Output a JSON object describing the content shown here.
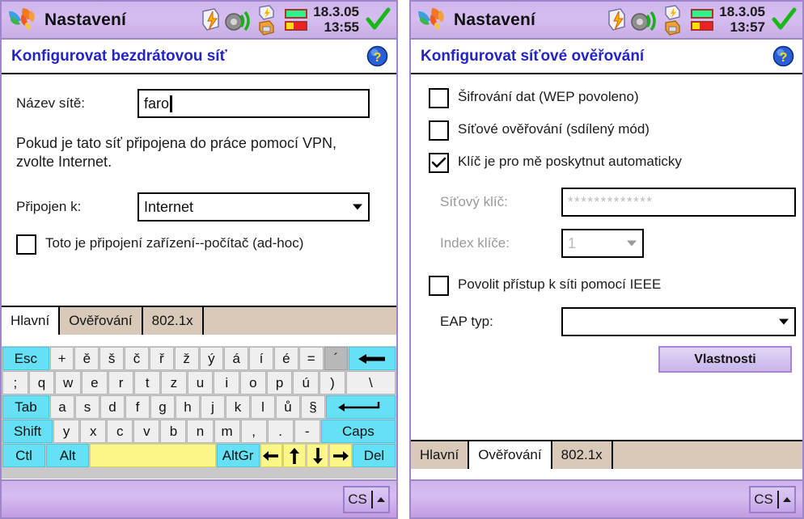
{
  "windows": [
    {
      "id": "wireless",
      "titlebar": {
        "app_title": "Nastavení",
        "date": "18.3.05",
        "time": "13:55",
        "icons": [
          "msn-butterfly-logo",
          "power-icon",
          "speaker-icon",
          "network-icon",
          "battery-green",
          "battery-red",
          "ok-check-icon"
        ]
      },
      "header": {
        "title": "Konfigurovat bezdrátovou síť",
        "help_icon": "help-question-icon"
      },
      "form": {
        "network_name_label": "Název sítě:",
        "network_name_value": "faro",
        "help_text": "Pokud je tato síť připojena do práce pomocí VPN, zvolte  Internet.",
        "connects_to_label": "Připojen k:",
        "connects_to_value": "Internet",
        "adhoc_label": "Toto je připojení  zařízení--počítač (ad-hoc)",
        "adhoc_checked": false
      },
      "tabs": [
        {
          "label": "Hlavní",
          "active": true
        },
        {
          "label": "Ověřování",
          "active": false
        },
        {
          "label": "802.1x",
          "active": false
        }
      ],
      "keyboard": {
        "rows": [
          [
            {
              "label": "Esc",
              "style": "cy",
              "width": "w2"
            },
            {
              "label": "+",
              "style": "",
              "width": ""
            },
            {
              "label": "ě",
              "style": "",
              "width": ""
            },
            {
              "label": "š",
              "style": "",
              "width": ""
            },
            {
              "label": "č",
              "style": "",
              "width": ""
            },
            {
              "label": "ř",
              "style": "",
              "width": ""
            },
            {
              "label": "ž",
              "style": "",
              "width": ""
            },
            {
              "label": "ý",
              "style": "",
              "width": ""
            },
            {
              "label": "á",
              "style": "",
              "width": ""
            },
            {
              "label": "í",
              "style": "",
              "width": ""
            },
            {
              "label": "é",
              "style": "",
              "width": ""
            },
            {
              "label": "=",
              "style": "",
              "width": ""
            },
            {
              "label": "´",
              "style": "gr",
              "width": ""
            },
            {
              "label": "backspace-arrow-icon",
              "style": "cy",
              "width": "w2",
              "icon": "backspace"
            }
          ],
          [
            {
              "label": ";",
              "style": "",
              "width": ""
            },
            {
              "label": "q",
              "style": "",
              "width": ""
            },
            {
              "label": "w",
              "style": "",
              "width": ""
            },
            {
              "label": "e",
              "style": "",
              "width": ""
            },
            {
              "label": "r",
              "style": "",
              "width": ""
            },
            {
              "label": "t",
              "style": "",
              "width": ""
            },
            {
              "label": "z",
              "style": "",
              "width": ""
            },
            {
              "label": "u",
              "style": "",
              "width": ""
            },
            {
              "label": "i",
              "style": "",
              "width": ""
            },
            {
              "label": "o",
              "style": "",
              "width": ""
            },
            {
              "label": "p",
              "style": "",
              "width": ""
            },
            {
              "label": "ú",
              "style": "",
              "width": ""
            },
            {
              "label": ")",
              "style": "",
              "width": ""
            },
            {
              "label": "\\",
              "style": "",
              "width": "w2"
            }
          ],
          [
            {
              "label": "Tab",
              "style": "cy",
              "width": "w2"
            },
            {
              "label": "a",
              "style": "",
              "width": ""
            },
            {
              "label": "s",
              "style": "",
              "width": ""
            },
            {
              "label": "d",
              "style": "",
              "width": ""
            },
            {
              "label": "f",
              "style": "",
              "width": ""
            },
            {
              "label": "g",
              "style": "",
              "width": ""
            },
            {
              "label": "h",
              "style": "",
              "width": ""
            },
            {
              "label": "j",
              "style": "",
              "width": ""
            },
            {
              "label": "k",
              "style": "",
              "width": ""
            },
            {
              "label": "l",
              "style": "",
              "width": ""
            },
            {
              "label": "ů",
              "style": "",
              "width": ""
            },
            {
              "label": "§",
              "style": "",
              "width": ""
            },
            {
              "label": "enter-arrow-icon",
              "style": "cy",
              "width": "w3",
              "icon": "enter"
            }
          ],
          [
            {
              "label": "Shift",
              "style": "cy",
              "width": "w2"
            },
            {
              "label": "y",
              "style": "",
              "width": ""
            },
            {
              "label": "x",
              "style": "",
              "width": ""
            },
            {
              "label": "c",
              "style": "",
              "width": ""
            },
            {
              "label": "v",
              "style": "",
              "width": ""
            },
            {
              "label": "b",
              "style": "",
              "width": ""
            },
            {
              "label": "n",
              "style": "",
              "width": ""
            },
            {
              "label": "m",
              "style": "",
              "width": ""
            },
            {
              "label": ",",
              "style": "",
              "width": ""
            },
            {
              "label": ".",
              "style": "",
              "width": ""
            },
            {
              "label": "-",
              "style": "",
              "width": ""
            },
            {
              "label": "Caps",
              "style": "cy",
              "width": "w3"
            }
          ],
          [
            {
              "label": "Ctl",
              "style": "cy",
              "width": "w2"
            },
            {
              "label": "Alt",
              "style": "cy",
              "width": "w2"
            },
            {
              "label": "",
              "style": "ye",
              "width": "w6"
            },
            {
              "label": "AltGr",
              "style": "cy",
              "width": "w2"
            },
            {
              "label": "left-arrow-icon",
              "style": "ye",
              "width": "",
              "icon": "left"
            },
            {
              "label": "up-arrow-icon",
              "style": "ye",
              "width": "",
              "icon": "up"
            },
            {
              "label": "down-arrow-icon",
              "style": "ye",
              "width": "",
              "icon": "down"
            },
            {
              "label": "right-arrow-icon",
              "style": "ye",
              "width": "",
              "icon": "right"
            },
            {
              "label": "Del",
              "style": "cy",
              "width": "w2"
            }
          ]
        ]
      },
      "statusbar": {
        "ime_label": "CS"
      }
    },
    {
      "id": "auth",
      "titlebar": {
        "app_title": "Nastavení",
        "date": "18.3.05",
        "time": "13:57",
        "icons": [
          "msn-butterfly-logo",
          "power-icon",
          "speaker-icon",
          "network-icon",
          "battery-green",
          "battery-red",
          "ok-check-icon"
        ]
      },
      "header": {
        "title": "Konfigurovat síťové ověřování",
        "help_icon": "help-question-icon"
      },
      "form": {
        "wep_label": "Šifrování dat (WEP povoleno)",
        "wep_checked": false,
        "shared_label": "Síťové ověřování (sdílený mód)",
        "shared_checked": false,
        "autokey_label": "Klíč je pro mě poskytnut automaticky",
        "autokey_checked": true,
        "netkey_label": "Síťový klíč:",
        "netkey_value": "*************",
        "keyindex_label": "Index klíče:",
        "keyindex_value": "1",
        "ieee_label": "Povolit přístup k síti pomocí IEEE",
        "ieee_checked": false,
        "eap_label": "EAP typ:",
        "eap_value": "",
        "properties_button": "Vlastnosti"
      },
      "tabs": [
        {
          "label": "Hlavní",
          "active": false
        },
        {
          "label": "Ověřování",
          "active": true
        },
        {
          "label": "802.1x",
          "active": false
        }
      ],
      "statusbar": {
        "ime_label": "CS"
      }
    }
  ],
  "colors": {
    "titlebar": "#d2b8ee",
    "header_text": "#2424c8",
    "tab_inactive": "#d8c9b8",
    "key_cyan": "#66e0f5",
    "key_yellow": "#fdf78a",
    "button_purple": "#d3c3ef"
  }
}
